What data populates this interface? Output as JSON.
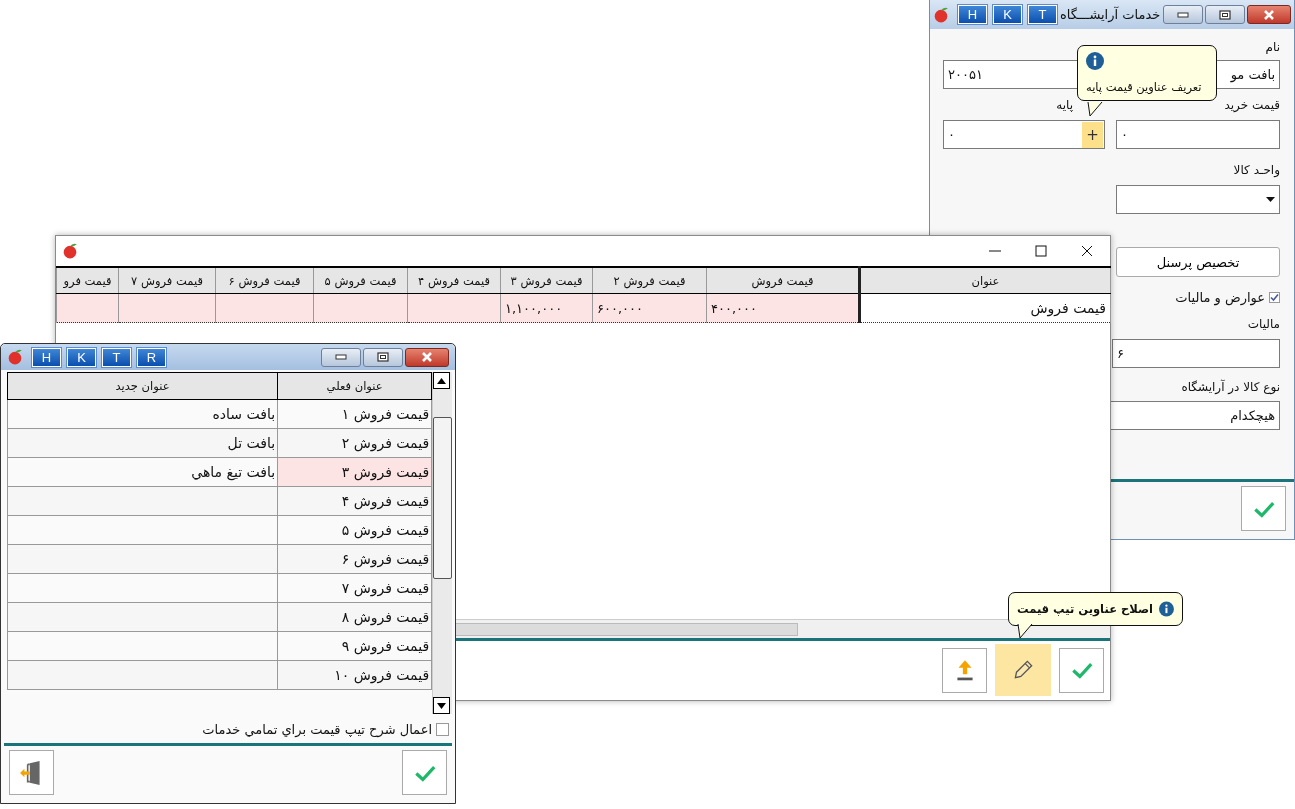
{
  "services_window": {
    "title": "خدمات آرایشـــگاه",
    "title_buttons": [
      "T",
      "K",
      "H"
    ],
    "name_label": "نام",
    "name_value": "بافت مو",
    "code_value": "۲۰۰۵۱",
    "purchase_label": "قیمت خرید",
    "base_label": "پایه",
    "purchase_value": "۰",
    "base_value": "۰",
    "base_add_button": "+",
    "unit_label": "واحـد کالا",
    "assign_button": "تخصیص پرسنل",
    "tax_checkbox": {
      "label": "عوارض و مالیات",
      "checked": true
    },
    "tax_label": "مالیات",
    "tax_value": "۶",
    "type_label": "نوع کالا در آرایشگاه",
    "type_value": "هیچکدام",
    "tooltip": "تعریف عناوین قیمت پایه"
  },
  "price_window": {
    "columns": [
      "عنوان",
      "قیمت فروش",
      "قیمت فروش ۲",
      "قیمت فروش ۳",
      "قیمت فروش ۴",
      "قیمت فروش ۵",
      "قیمت فروش ۶",
      "قیمت فروش ۷",
      "قیمت فرو"
    ],
    "rows": [
      {
        "title": "قیمت فروش",
        "prices": [
          "۴۰۰,۰۰۰",
          "۶۰۰,۰۰۰",
          "۱,۱۰۰,۰۰۰"
        ]
      }
    ],
    "toolbar": [
      {
        "kind": "confirm",
        "highlighted": false
      },
      {
        "kind": "edit",
        "highlighted": true
      },
      {
        "kind": "upload",
        "highlighted": false
      }
    ],
    "tooltip": "اصلاح عناوین تیپ قیمت"
  },
  "titles_window": {
    "title_buttons": [
      "R",
      "T",
      "K",
      "H"
    ],
    "columns": [
      "عنوان فعلي",
      "عنوان جديد"
    ],
    "rows": [
      {
        "current": "قیمت فروش ۱",
        "new": "بافت ساده",
        "selected": false
      },
      {
        "current": "قیمت فروش ۲",
        "new": "بافت تل",
        "selected": false
      },
      {
        "current": "قیمت فروش ۳",
        "new": "بافت تیغ ماهي",
        "selected": true
      },
      {
        "current": "قیمت فروش ۴",
        "selected": false
      },
      {
        "current": "قیمت فروش ۵",
        "selected": false
      },
      {
        "current": "قیمت فروش ۶",
        "selected": false
      },
      {
        "current": "قیمت فروش ۷",
        "selected": false
      },
      {
        "current": "قیمت فروش ۸",
        "selected": false
      },
      {
        "current": "قیمت فروش ۹",
        "selected": false
      },
      {
        "current": "قیمت فروش ۱۰",
        "selected": false
      }
    ],
    "apply_all": {
      "label": "اعمال شرح تیپ قیمت براي تمامي خدمات",
      "checked": false
    }
  }
}
